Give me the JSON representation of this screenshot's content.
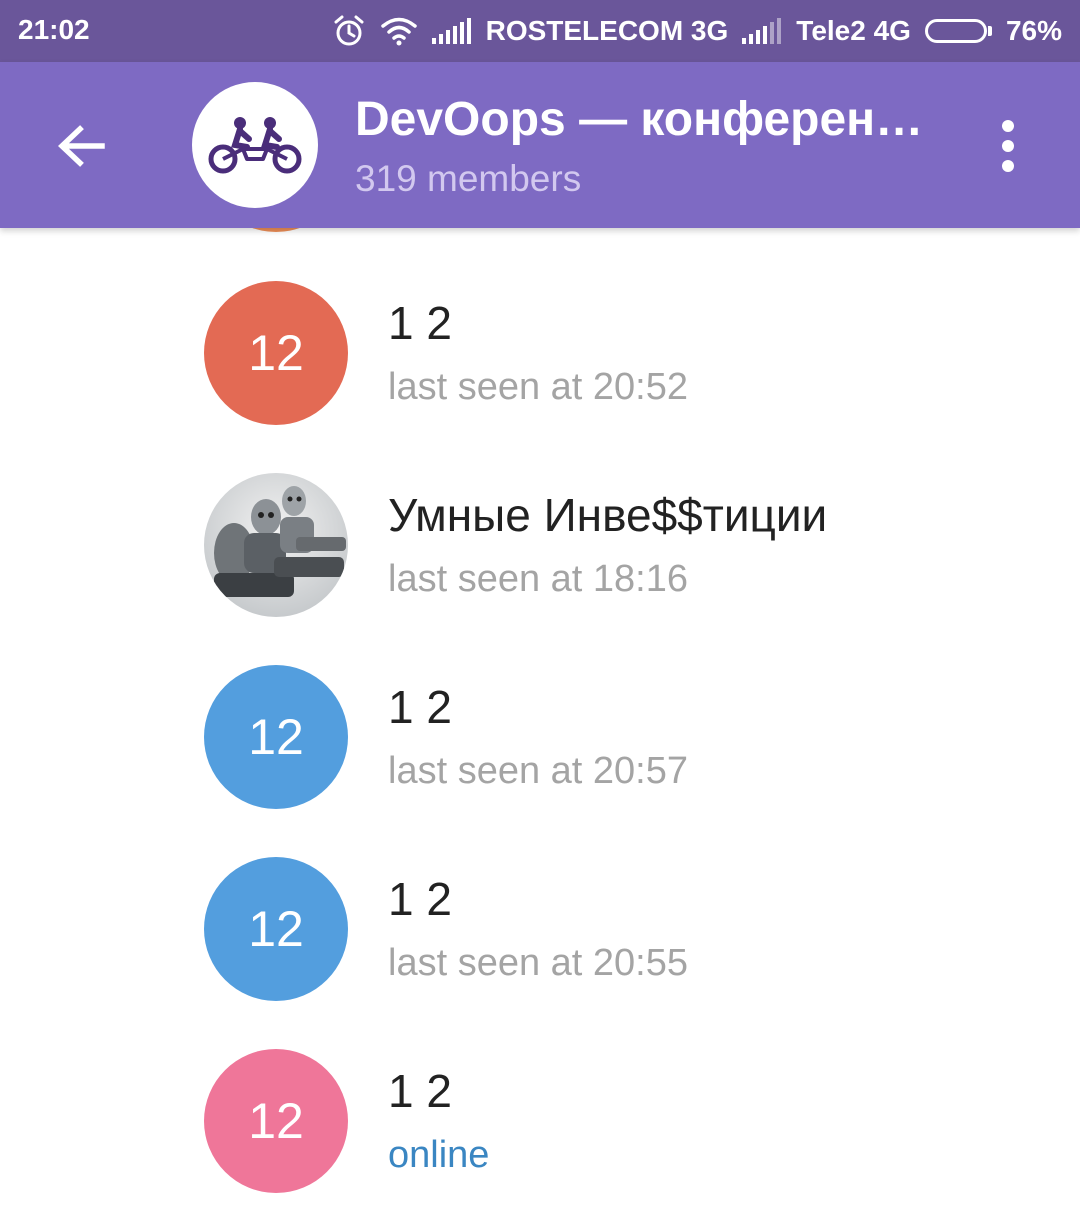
{
  "status_bar": {
    "time": "21:02",
    "carrier1": "ROSTELECOM 3G",
    "carrier2": "Tele2 4G",
    "battery_percent": "76%",
    "battery_level": 0.76,
    "icons": [
      "alarm-icon",
      "wifi-icon",
      "signal-icon",
      "signal-icon",
      "battery-icon"
    ]
  },
  "header": {
    "title": "DevOops — конферен…",
    "subtitle": "319 members",
    "back_icon": "back-arrow-icon",
    "menu_icon": "more-vert-icon",
    "avatar_icon": "tandem-bike-logo"
  },
  "colors": {
    "status_bar": "#6a569a",
    "toolbar": "#7e6ac3",
    "online": "#3a86c2",
    "status_text": "#a4a4a4"
  },
  "members": [
    {
      "initials": "12",
      "name": "1 2",
      "status": "last seen at 20:52",
      "avatar_color": "#e36a54",
      "online": false
    },
    {
      "initials": "",
      "name": "Умные Инве$$тиции",
      "status": "last seen at 18:16",
      "avatar_color": "#c8c8c8",
      "online": false,
      "photo": true
    },
    {
      "initials": "12",
      "name": "1 2",
      "status": "last seen at 20:57",
      "avatar_color": "#539ede",
      "online": false
    },
    {
      "initials": "12",
      "name": "1 2",
      "status": "last seen at 20:55",
      "avatar_color": "#539ede",
      "online": false
    },
    {
      "initials": "12",
      "name": "1 2",
      "status": "online",
      "avatar_color": "#ef7699",
      "online": true
    }
  ]
}
